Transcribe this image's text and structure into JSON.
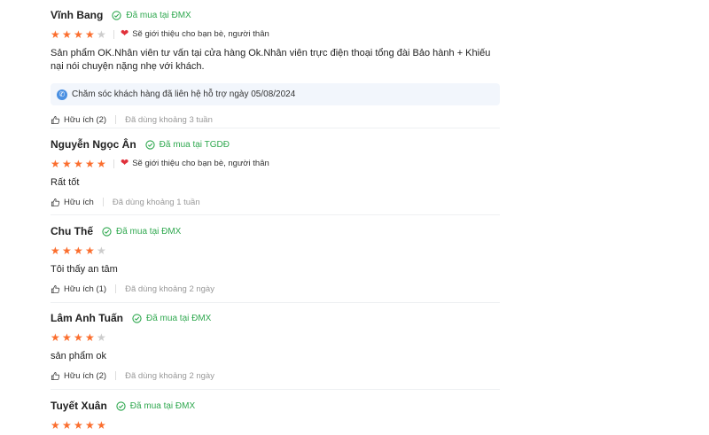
{
  "reviews": [
    {
      "name": "Vĩnh Bang",
      "badge": "Đã mua tại ĐMX",
      "rating": 4,
      "recommend": "Sẽ giới thiệu cho bạn bè, người thân",
      "content": "Sản phẩm OK.Nhân viên tư vấn tại cửa hàng Ok.Nhân viên trực điện thoại tổng đài Bảo hành + Khiếu nại nói chuyện nặng nhẹ với khách.",
      "reply": "Chăm sóc khách hàng đã liên hệ hỗ trợ ngày 05/08/2024",
      "helpful": "Hữu ích (2)",
      "used": "Đã dùng khoảng 3 tuần"
    },
    {
      "name": "Nguyễn Ngọc Ân",
      "badge": "Đã mua tại TGDĐ",
      "rating": 5,
      "recommend": "Sẽ giới thiệu cho bạn bè, người thân",
      "content": "Rất tốt",
      "helpful": "Hữu ích",
      "used": "Đã dùng khoảng 1 tuần"
    },
    {
      "name": "Chu Thế",
      "badge": "Đã mua tại ĐMX",
      "rating": 4,
      "content": "Tôi thấy an tâm",
      "helpful": "Hữu ích (1)",
      "used": "Đã dùng khoảng 2 ngày"
    },
    {
      "name": "Lâm Anh Tuấn",
      "badge": "Đã mua tại ĐMX",
      "rating": 4,
      "content": "sản phẩm ok",
      "helpful": "Hữu ích (2)",
      "used": "Đã dùng khoảng 2 ngày"
    },
    {
      "name": "Tuyết Xuân",
      "badge": "Đã mua tại ĐMX",
      "rating": 5
    }
  ],
  "icons": {
    "verified": "check-circle-icon",
    "star": "star-icon",
    "recommend": "heart-icon",
    "reply": "support-agent-icon",
    "helpful": "thumbs-up-icon"
  },
  "colors": {
    "star": "#fb6e2e",
    "verified": "#2fa84f",
    "heart": "#e0303a",
    "reply_bg": "#f2f6fc"
  }
}
